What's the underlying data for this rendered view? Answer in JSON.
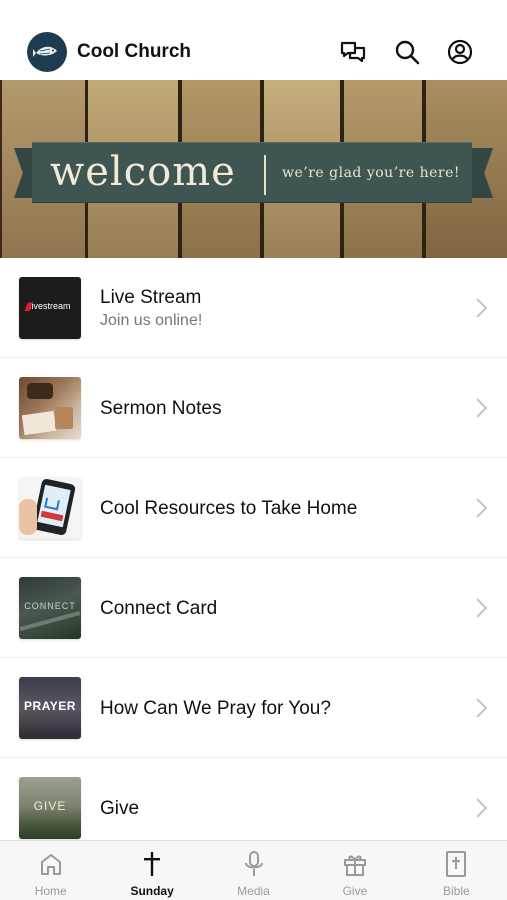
{
  "app": {
    "title": "Cool Church"
  },
  "header": {
    "icons": [
      "chat-icon",
      "search-icon",
      "account-icon"
    ]
  },
  "banner": {
    "welcome": "welcome",
    "tagline": "we’re glad you’re here!"
  },
  "list": [
    {
      "title": "Live Stream",
      "subtitle": "Join us online!",
      "thumb_label": "livestream",
      "thumb_icon": "livestream-logo"
    },
    {
      "title": "Sermon Notes",
      "thumb_icon": "notes-photo"
    },
    {
      "title": "Cool Resources to Take Home",
      "thumb_icon": "phone-cart-photo"
    },
    {
      "title": "Connect Card",
      "thumb_label": "CONNECT",
      "thumb_icon": "connect-photo"
    },
    {
      "title": "How Can We Pray for You?",
      "thumb_label": "PRAYER",
      "thumb_icon": "prayer-photo"
    },
    {
      "title": "Give",
      "thumb_label": "GIVE",
      "thumb_icon": "give-photo"
    }
  ],
  "tabs": [
    {
      "label": "Home",
      "icon": "home-icon",
      "active": false
    },
    {
      "label": "Sunday",
      "icon": "cross-icon",
      "active": true
    },
    {
      "label": "Media",
      "icon": "microphone-icon",
      "active": false
    },
    {
      "label": "Give",
      "icon": "gift-icon",
      "active": false
    },
    {
      "label": "Bible",
      "icon": "bible-icon",
      "active": false
    }
  ],
  "colors": {
    "ribbon": "#3e5551",
    "active_tab": "#111111",
    "inactive_tab": "#9a9a9a"
  }
}
